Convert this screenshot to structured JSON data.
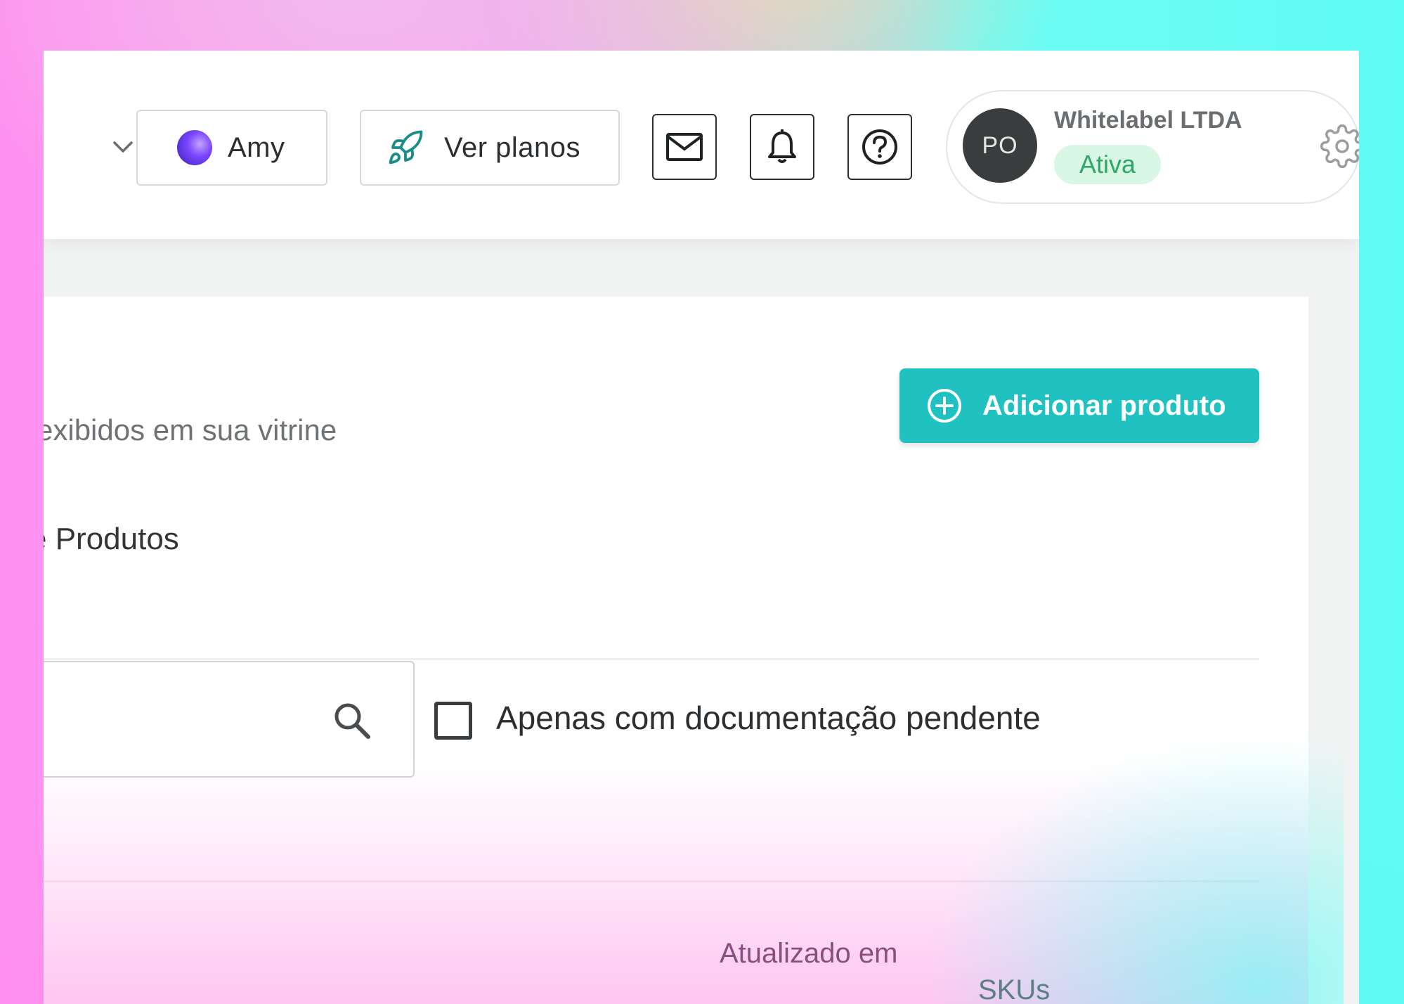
{
  "header": {
    "account_dropdown": {
      "label": "Amy"
    },
    "plans_button": {
      "label": "Ver planos"
    },
    "profile": {
      "initials": "PO",
      "company_name": "Whitelabel LTDA",
      "status": "Ativa"
    }
  },
  "main": {
    "subtitle": "exibidos em sua vitrine",
    "add_product_button": {
      "label": "Adicionar produto"
    },
    "section_title": "e Produtos",
    "search": {
      "value": "",
      "placeholder": ""
    },
    "filter_pending_docs": {
      "label": "Apenas com documentação pendente",
      "checked": false
    },
    "table": {
      "columns": [
        "Atualizado em",
        "SKUs"
      ]
    }
  },
  "colors": {
    "accent": "#1fc2c0",
    "status_badge_bg": "#d8f7e5",
    "status_badge_text": "#2fa866",
    "avatar_bg": "#3a3d3e"
  },
  "icons": {
    "chevron": "chevron-down-icon",
    "amy": "amy-orb-icon",
    "plans": "rocket-icon",
    "mail": "mail-icon",
    "notifications": "bell-icon",
    "help": "help-circle-icon",
    "settings": "gear-icon",
    "add": "plus-circle-icon",
    "search": "search-icon"
  }
}
